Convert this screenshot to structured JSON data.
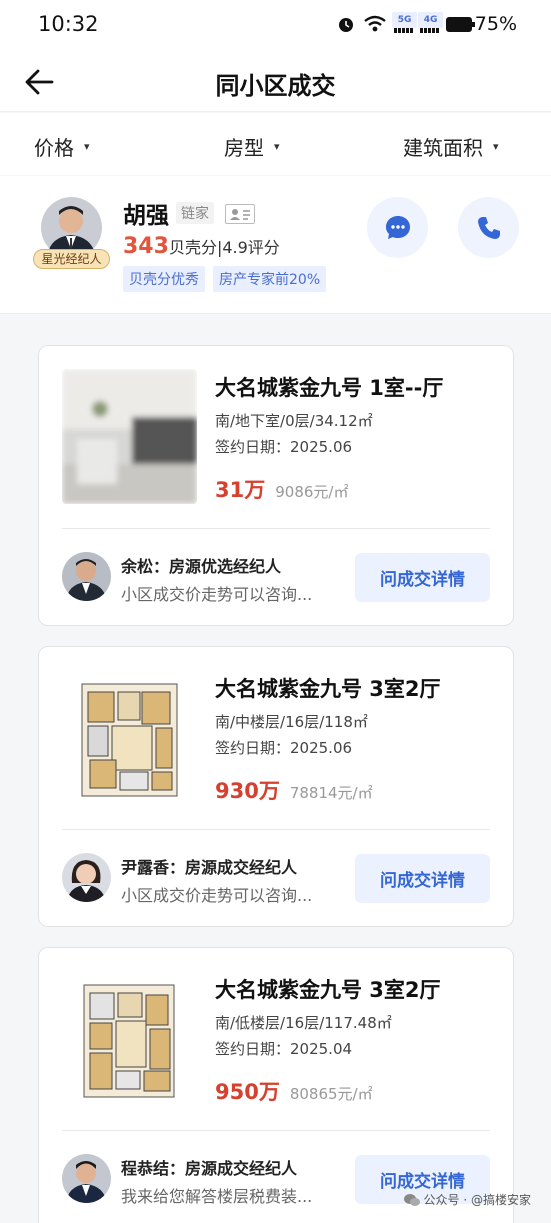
{
  "status": {
    "time": "10:32",
    "net1": "5G",
    "net2": "4G",
    "battery": "75%"
  },
  "nav": {
    "title": "同小区成交"
  },
  "filters": [
    "价格",
    "房型",
    "建筑面积"
  ],
  "agent": {
    "name": "胡强",
    "brand": "链家",
    "badge": "星光经纪人",
    "score": "343",
    "score_rest": "贝壳分|4.9评分",
    "tags": [
      "贝壳分优秀",
      "房产专家前20%"
    ]
  },
  "listings": [
    {
      "title": "大名城紫金九号 1室--厅",
      "info": "南/地下室/0层/34.12㎡",
      "date": "签约日期：2025.06",
      "price": "31万",
      "unit_price": "9086元/㎡",
      "agent_role": "余松：房源优选经纪人",
      "agent_msg": "小区成交价走势可以咨询...",
      "button": "问成交详情"
    },
    {
      "title": "大名城紫金九号 3室2厅",
      "info": "南/中楼层/16层/118㎡",
      "date": "签约日期：2025.06",
      "price": "930万",
      "unit_price": "78814元/㎡",
      "agent_role": "尹露香：房源成交经纪人",
      "agent_msg": "小区成交价走势可以咨询...",
      "button": "问成交详情"
    },
    {
      "title": "大名城紫金九号 3室2厅",
      "info": "南/低楼层/16层/117.48㎡",
      "date": "签约日期：2025.04",
      "price": "950万",
      "unit_price": "80865元/㎡",
      "agent_role": "程恭结：房源成交经纪人",
      "agent_msg": "我来给您解答楼层税费装...",
      "button": "问成交详情"
    }
  ],
  "watermark": "公众号 · @搞楼安家",
  "colors": {
    "accent": "#3566d6",
    "price": "#d6402e",
    "score": "#e4533a"
  }
}
